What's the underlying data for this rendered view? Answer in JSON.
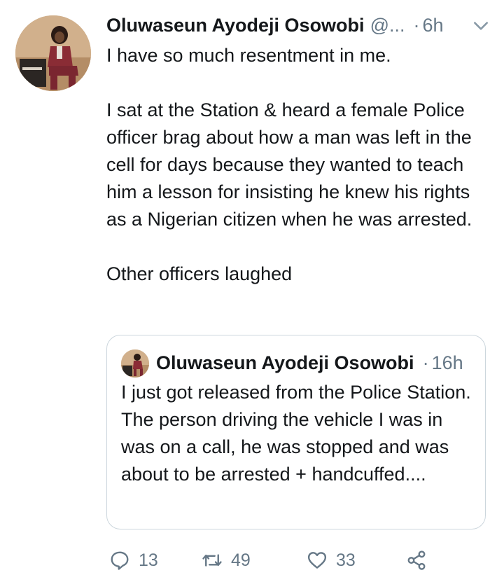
{
  "tweet": {
    "author_name": "Oluwaseun Ayodeji Osowobi",
    "handle": "@...",
    "separator": "·",
    "time": "6h",
    "text": "I have so much resentment in me.\n\nI sat at the Station & heard a female Police officer brag about how a man was left in the cell for days because they wanted to teach him a lesson for insisting he knew his rights as a Nigerian citizen when he was arrested.\n\nOther officers laughed"
  },
  "quoted": {
    "author_name": "Oluwaseun Ayodeji Osowobi",
    "separator": "·",
    "time": "16h",
    "text": "I just got released from the Police Station. The person driving the vehicle I was in was on a call, he was stopped and was about to be arrested + handcuffed...."
  },
  "actions": {
    "reply_count": "13",
    "retweet_count": "49",
    "like_count": "33"
  },
  "colors": {
    "text": "#14171a",
    "secondary": "#657786",
    "border": "#ccd6dd"
  }
}
